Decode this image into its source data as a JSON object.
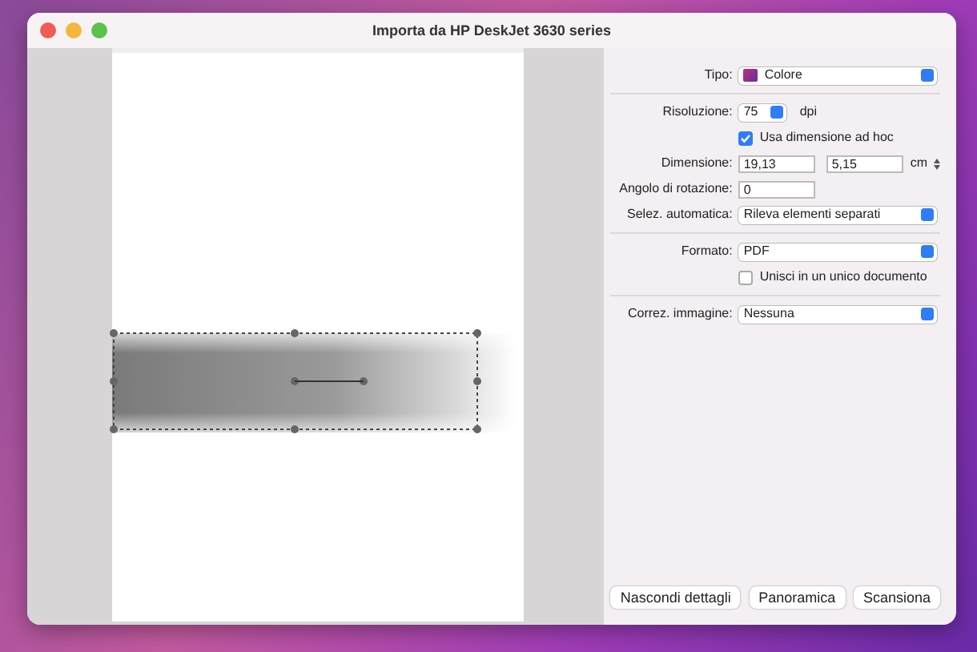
{
  "window": {
    "title": "Importa da HP DeskJet 3630 series"
  },
  "groups": [
    [
      {
        "kind": "color-popup",
        "label": "Tipo:",
        "value": "Colore"
      }
    ],
    [
      {
        "kind": "small-popup",
        "label": "Risoluzione:",
        "value": "75",
        "unit": "dpi"
      },
      {
        "kind": "checkbox",
        "text": "Usa dimensione ad hoc",
        "checked": true
      },
      {
        "kind": "pair",
        "label": "Dimensione:",
        "values": [
          "19,13",
          "5,15"
        ],
        "unit": "cm"
      },
      {
        "kind": "field",
        "label": "Angolo di rotazione:",
        "value": "0"
      },
      {
        "kind": "popup",
        "label": "Selez. automatica:",
        "value": "Rileva elementi separati"
      }
    ],
    [
      {
        "kind": "popup",
        "label": "Formato:",
        "value": "PDF"
      },
      {
        "kind": "checkbox",
        "text": "Unisci in un unico documento",
        "checked": false
      }
    ],
    [
      {
        "kind": "popup",
        "label": "Correz. immagine:",
        "value": "Nessuna"
      }
    ]
  ],
  "buttons": [
    "Nascondi dettagli",
    "Panoramica",
    "Scansiona"
  ]
}
